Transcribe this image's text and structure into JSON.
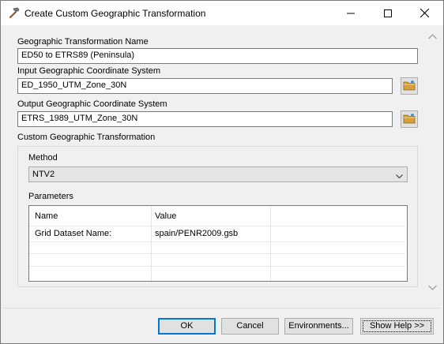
{
  "window": {
    "title": "Create Custom Geographic Transformation",
    "app_icon": "hammer-icon",
    "controls": {
      "minimize": "minimize-icon",
      "maximize": "maximize-icon",
      "close": "close-icon"
    }
  },
  "form": {
    "name_label": "Geographic Transformation Name",
    "name_value": "ED50 to ETRS89 (Peninsula)",
    "input_label": "Input Geographic Coordinate System",
    "input_value": "ED_1950_UTM_Zone_30N",
    "output_label": "Output Geographic Coordinate System",
    "output_value": "ETRS_1989_UTM_Zone_30N",
    "custom_label": "Custom Geographic Transformation",
    "method_label": "Method",
    "method_value": "NTV2",
    "parameters_label": "Parameters",
    "parameters_table": {
      "columns": [
        "Name",
        "Value"
      ],
      "rows": [
        {
          "name": "Grid Dataset Name:",
          "value": "spain/PENR2009.gsb"
        }
      ]
    }
  },
  "buttons": {
    "ok": "OK",
    "cancel": "Cancel",
    "environments": "Environments...",
    "show_help": "Show Help >>"
  },
  "colors": {
    "window_bg": "#f0f0f0",
    "accent": "#0078d7",
    "folder": "#d8a03a"
  }
}
